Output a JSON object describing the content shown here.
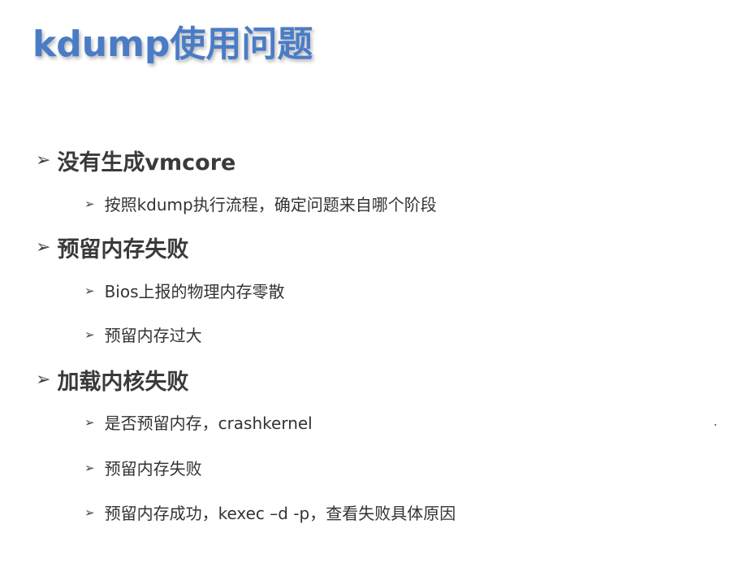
{
  "title": "kdump使用问题",
  "sections": [
    {
      "heading": "没有生成vmcore",
      "items": [
        "按照kdump执行流程，确定问题来自哪个阶段"
      ]
    },
    {
      "heading": "预留内存失败",
      "items": [
        "Bios上报的物理内存零散",
        "预留内存过大"
      ]
    },
    {
      "heading": "加载内核失败",
      "items": [
        "是否预留内存，crashkernel",
        "预留内存失败",
        "预留内存成功，kexec –d -p，查看失败具体原因"
      ]
    }
  ],
  "bullet_glyph": "➢",
  "colors": {
    "title": "#4a7cc6",
    "heading": "#3a3a3a",
    "body": "#333333"
  }
}
